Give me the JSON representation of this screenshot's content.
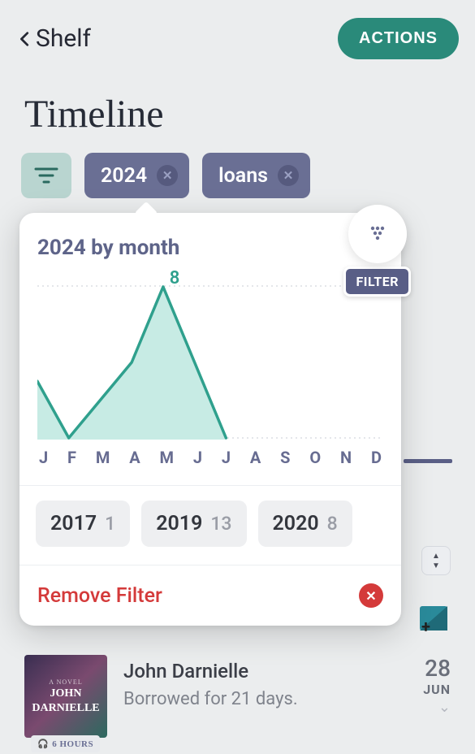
{
  "header": {
    "back_label": "Shelf",
    "actions_label": "ACTIONS"
  },
  "page_title": "Timeline",
  "chips": [
    {
      "label": "2024"
    },
    {
      "label": "loans"
    }
  ],
  "popup": {
    "title": "2024 by month",
    "filter_badge": "FILTER",
    "peak_label": "8",
    "months": [
      "J",
      "F",
      "M",
      "A",
      "M",
      "J",
      "J",
      "A",
      "S",
      "O",
      "N",
      "D"
    ],
    "years": [
      {
        "year": "2017",
        "count": "1"
      },
      {
        "year": "2019",
        "count": "13"
      },
      {
        "year": "2020",
        "count": "8"
      }
    ],
    "remove_label": "Remove Filter"
  },
  "chart_data": {
    "type": "area",
    "title": "2024 by month",
    "categories": [
      "J",
      "F",
      "M",
      "A",
      "M",
      "J",
      "J",
      "A",
      "S",
      "O",
      "N",
      "D"
    ],
    "values": [
      3,
      0,
      2,
      4,
      8,
      4,
      0,
      0,
      0,
      0,
      0,
      0
    ],
    "ylim": [
      0,
      8
    ],
    "xlabel": "",
    "ylabel": ""
  },
  "list": {
    "cover_line1": "JOHN",
    "cover_line2": "DARNIELLE",
    "duration": "6 HOURS",
    "author": "John Darnielle",
    "status": "Borrowed for 21 days.",
    "day": "28",
    "month": "JUN"
  }
}
